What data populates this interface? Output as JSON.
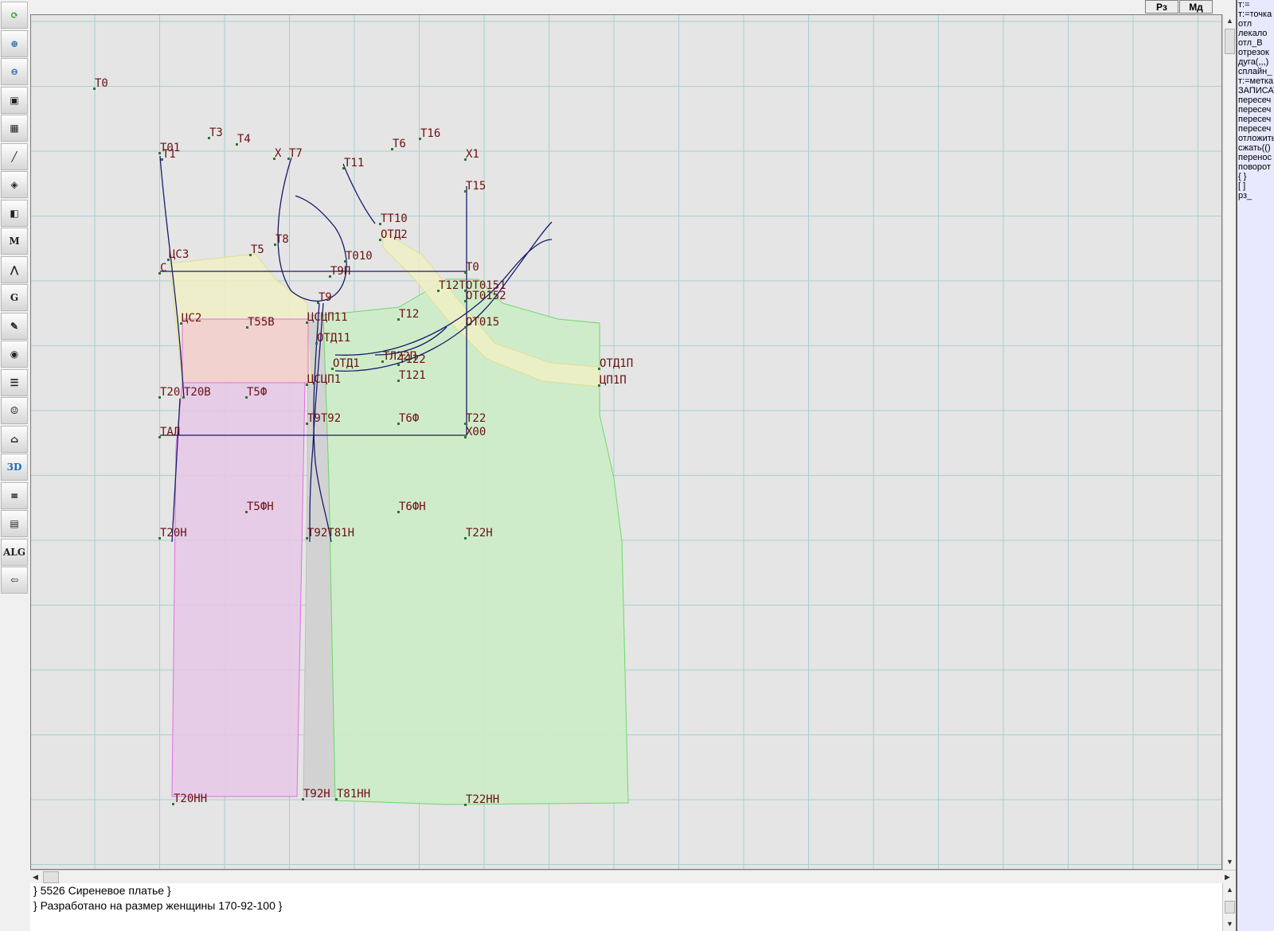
{
  "toolbar": {
    "tools": [
      "refresh-icon",
      "zoom-in-icon",
      "zoom-out-icon",
      "zoom-fit-icon",
      "grid-icon",
      "line-tool-icon",
      "layers-icon",
      "pattern-icon",
      "macro-m-icon",
      "compass-icon",
      "grading-g-icon",
      "measurements-icon",
      "camera-icon",
      "table-icon",
      "model-photo-icon",
      "garment-icon",
      "3d-icon",
      "list-icon",
      "stack-icon",
      "alg-icon",
      "exit-icon"
    ]
  },
  "top_buttons": {
    "rz": "Рз",
    "md": "Мд"
  },
  "command_panel": [
    "т:=",
    "т:=точка",
    "отл",
    "лекало",
    "отл_В",
    "отрезок",
    "дуга(,,,)",
    "сплайн_",
    "т:=метка",
    "ЗАПИСАТЬ",
    "пересеч",
    "пересеч",
    "пересеч",
    "пересеч",
    "отложить",
    "сжать(()",
    "перенос",
    "поворот",
    "{ }",
    "[ ]",
    "рз_"
  ],
  "comments": [
    "} 5526  Сиреневое платье }",
    "} Разработано на размер женщины 170-92-100 }"
  ],
  "pattern_labels": [
    "Т0",
    "Т3",
    "Т4",
    "Т16",
    "Т01",
    "Т1",
    "Х",
    "Т7",
    "Т11",
    "Т6",
    "Х1",
    "Т15",
    "ТТ10",
    "ОТД2",
    "Т8",
    "Т5",
    "ЦС3",
    "Т010",
    "С",
    "Т9П",
    "Т0",
    "Т12Т",
    "ОТ0151",
    "Т9",
    "ОТ0152",
    "ЦС2",
    "Т55В",
    "ЦСЦП11",
    "Т12",
    "ОТ015",
    "ОТД11",
    "ТЛ22П",
    "Т122",
    "ОТД1П",
    "ОТД1",
    "ЦП1П",
    "Т121",
    "ЦСЦП1",
    "Т20",
    "Т20В",
    "Т5Ф",
    "Т9Т92",
    "Т6Ф",
    "Т22",
    "ТАЛ",
    "Х00",
    "Т5ФН",
    "Т6ФН",
    "Т20Н",
    "Т92Т81Н",
    "Т22Н",
    "Т20НН",
    "Т92Н",
    "Т81НН",
    "Т22НН"
  ],
  "colors": {
    "canvas": "#e5e5e5",
    "grid": "#a8cfd0",
    "line": "#1a1a6e",
    "label": "#6b1010",
    "fill_green": "#ccecc6",
    "fill_pink": "#e6c8e6",
    "fill_yellow": "#f0f0c6"
  }
}
